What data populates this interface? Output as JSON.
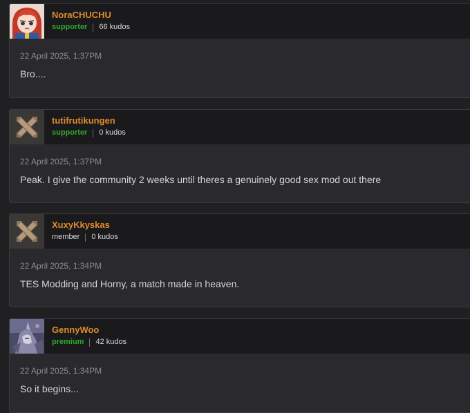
{
  "comments": [
    {
      "username": "NoraCHUCHU",
      "role": "supporter",
      "kudos": "66 kudos",
      "timestamp": "22 April 2025, 1:37PM",
      "text": "Bro....",
      "avatar": "anime-girl-avatar"
    },
    {
      "username": "tutifrutikungen",
      "role": "supporter",
      "kudos": "0 kudos",
      "timestamp": "22 April 2025, 1:37PM",
      "text": "Peak. I give the community 2 weeks until theres a genuinely good sex mod out there",
      "avatar": "default-nexus-avatar"
    },
    {
      "username": "XuxyKkyskas",
      "role": "member",
      "kudos": "0 kudos",
      "timestamp": "22 April 2025, 1:34PM",
      "text": "TES Modding and Horny, a match made in heaven.",
      "avatar": "default-nexus-avatar"
    },
    {
      "username": "GennyWoo",
      "role": "premium",
      "kudos": "42 kudos",
      "timestamp": "22 April 2025, 1:34PM",
      "text": "So it begins...",
      "avatar": "armored-character-avatar"
    }
  ],
  "colors": {
    "username": "#e08a2b",
    "role_highlight": "#2fa82a",
    "background": "#202023",
    "card": "#2a2a2e",
    "header": "#1a1a1d"
  }
}
